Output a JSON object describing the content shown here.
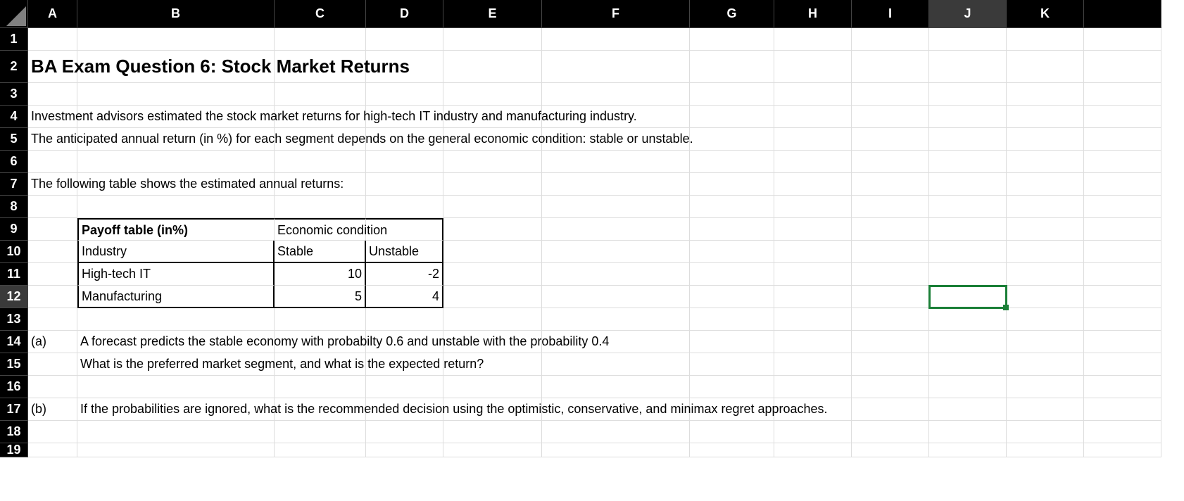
{
  "columns": [
    "A",
    "B",
    "C",
    "D",
    "E",
    "F",
    "G",
    "H",
    "I",
    "J",
    "K"
  ],
  "rows": [
    "1",
    "2",
    "3",
    "4",
    "5",
    "6",
    "7",
    "8",
    "9",
    "10",
    "11",
    "12",
    "13",
    "14",
    "15",
    "16",
    "17",
    "18",
    "19"
  ],
  "selected_column": "J",
  "selected_row": "12",
  "title": "BA Exam Question 6: Stock Market Returns",
  "text": {
    "line4": "Investment advisors estimated the stock market returns for high-tech IT industry and manufacturing industry.",
    "line5": "The anticipated annual return (in %) for each segment depends on the general economic condition: stable or unstable.",
    "line7": "The following table shows the estimated annual returns:",
    "q_a_label": "(a)",
    "q_a_1": "A forecast predicts the stable economy with probabilty 0.6 and unstable with the probability 0.4",
    "q_a_2": "What is the preferred market segment, and what is the expected return?",
    "q_b_label": "(b)",
    "q_b_1": "If the probabilities are ignored, what is the recommended decision using the optimistic, conservative, and minimax regret approaches."
  },
  "table": {
    "header_b9": "Payoff table (in%)",
    "header_c9": "Economic condition",
    "header_b10": "Industry",
    "header_c10": "Stable",
    "header_d10": "Unstable",
    "row1_label": "High-tech IT",
    "row1_stable": "10",
    "row1_unstable": "-2",
    "row2_label": "Manufacturing",
    "row2_stable": "5",
    "row2_unstable": "4"
  }
}
